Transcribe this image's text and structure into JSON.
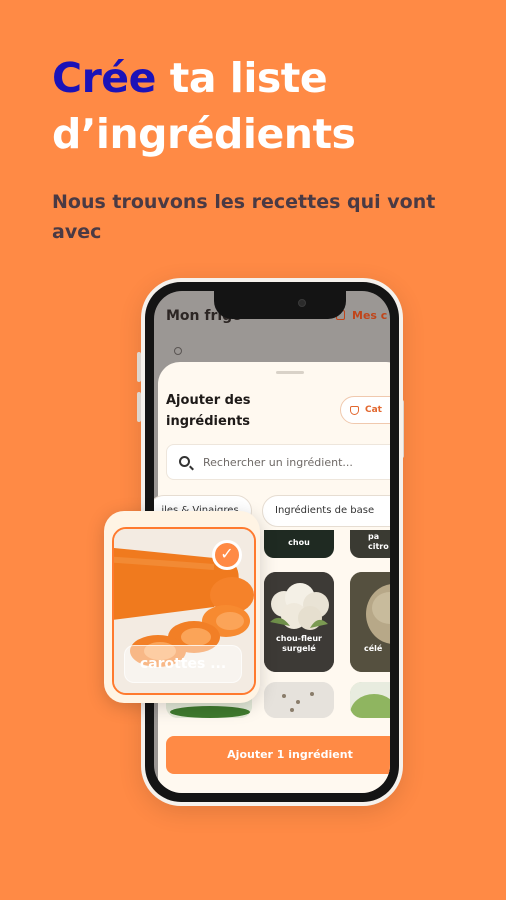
{
  "headline": {
    "accent": "Crée",
    "rest": "ta liste d’ingrédients"
  },
  "subline": "Nous trouvons les recettes qui vont avec",
  "app": {
    "background_title": "Mon frigo",
    "background_link": "Mes c",
    "sheet_title": "Ajouter des ingrédients",
    "category_button": "Cat",
    "search_placeholder": "Rechercher un ingrédient...",
    "chips": [
      "iles & Vinaigres",
      "Ingrédients de base"
    ],
    "tiles": [
      {
        "label": "chou"
      },
      {
        "label": "pa\ncitro"
      },
      {
        "label": "chou-fleur\nsurgelé"
      },
      {
        "label": "célé"
      }
    ],
    "add_button": "Ajouter 1 ingrédient"
  },
  "selected_card": {
    "label": "carottes ...",
    "check": "✓"
  },
  "colors": {
    "background": "#FF8A45",
    "accent_text": "#1B12B8",
    "sheet": "#FFF9F0"
  }
}
